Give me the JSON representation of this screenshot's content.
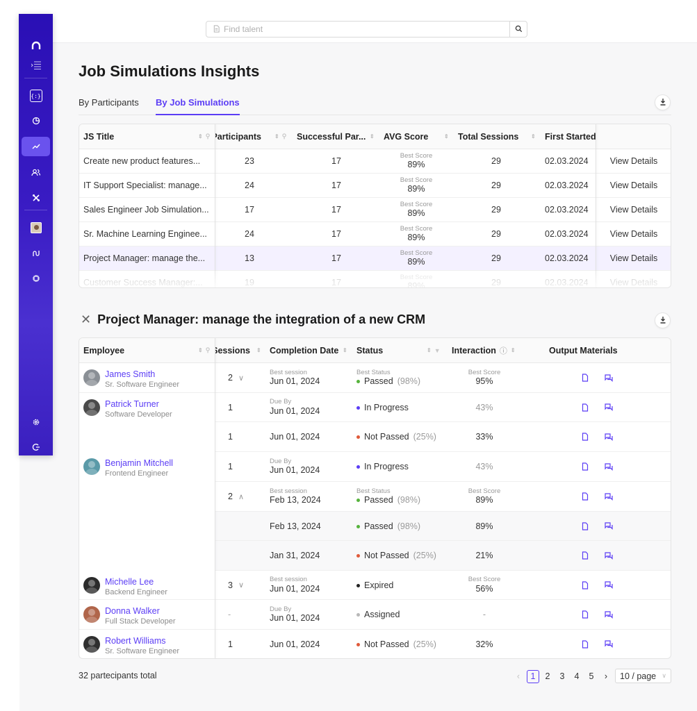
{
  "search": {
    "placeholder": "Find talent"
  },
  "page": {
    "title": "Job Simulations Insights"
  },
  "tabs": [
    {
      "label": "By Participants",
      "active": false
    },
    {
      "label": "By Job Simulations",
      "active": true
    }
  ],
  "colors": {
    "accent": "#5b3df5",
    "sidebar": "#3a1cc4",
    "passed": "#56b33c",
    "not_passed": "#e05a3a",
    "in_progress": "#5b3df5",
    "expired": "#222222",
    "assigned": "#b8b8b8"
  },
  "sidebar": {
    "icons": [
      "logo-icon",
      "menu-collapse-icon",
      "code-braces-icon",
      "pie-chart-icon",
      "trend-chart-icon",
      "users-icon",
      "tools-icon",
      "profile-avatar",
      "route-icon",
      "chip-icon",
      "settings-icon",
      "logout-icon"
    ]
  },
  "js_table": {
    "headers": {
      "title": "JS Title",
      "participants": "Participants",
      "successful": "Successful Par...",
      "avg": "AVG Score",
      "sessions": "Total Sessions",
      "first": "First Started"
    },
    "rows": [
      {
        "title": "Create new product features...",
        "participants": "23",
        "successful": "17",
        "score_label": "Best Score",
        "score": "89%",
        "sessions": "29",
        "first": "02.03.2024",
        "action": "View Details"
      },
      {
        "title": "IT Support Specialist: manage...",
        "participants": "24",
        "successful": "17",
        "score_label": "Best Score",
        "score": "89%",
        "sessions": "29",
        "first": "02.03.2024",
        "action": "View Details"
      },
      {
        "title": "Sales Engineer Job Simulation...",
        "participants": "17",
        "successful": "17",
        "score_label": "Best Score",
        "score": "89%",
        "sessions": "29",
        "first": "02.03.2024",
        "action": "View Details"
      },
      {
        "title": "Sr. Machine Learning Enginee...",
        "participants": "24",
        "successful": "17",
        "score_label": "Best Score",
        "score": "89%",
        "sessions": "29",
        "first": "02.03.2024",
        "action": "View Details"
      },
      {
        "title": "Project Manager: manage the...",
        "participants": "13",
        "successful": "17",
        "score_label": "Best Score",
        "score": "89%",
        "sessions": "29",
        "first": "02.03.2024",
        "action": "View Details"
      },
      {
        "title": "Customer Success Manager:...",
        "participants": "19",
        "successful": "17",
        "score_label": "Best Score",
        "score": "89%",
        "sessions": "29",
        "first": "02.03.2024",
        "action": "View Details"
      }
    ]
  },
  "details": {
    "title": "Project Manager: manage the integration of a new CRM",
    "headers": {
      "employee": "Employee",
      "sessions": "Sessions",
      "completion": "Completion Date",
      "status": "Status",
      "interaction": "Interaction",
      "output": "Output Materials"
    },
    "rows": [
      {
        "name": "James Smith",
        "role": "Sr. Software Engineer",
        "sessions": "2",
        "chev": "∨",
        "date_label": "Best session",
        "date": "Jun 01, 2024",
        "status_label": "Best Status",
        "status": "Passed",
        "status_pct": "(98%)",
        "score_label": "Best Score",
        "score": "95%"
      },
      {
        "name": "Patrick Turner",
        "role": "Software Developer",
        "sessions": "1",
        "date_label": "Due By",
        "date": "Jun 01, 2024",
        "status": "In Progress",
        "score": "43%"
      },
      {
        "sessions": "1",
        "date": "Jun 01, 2024",
        "status": "Not Passed",
        "status_pct": "(25%)",
        "score": "33%"
      },
      {
        "name": "Benjamin Mitchell",
        "role": "Frontend Engineer",
        "sessions": "1",
        "date_label": "Due By",
        "date": "Jun 01, 2024",
        "status": "In Progress",
        "score": "43%"
      },
      {
        "sessions": "2",
        "chev": "∧",
        "date_label": "Best session",
        "date": "Feb 13, 2024",
        "status_label": "Best Status",
        "status": "Passed",
        "status_pct": "(98%)",
        "score_label": "Best Score",
        "score": "89%"
      },
      {
        "date": "Feb 13, 2024",
        "status": "Passed",
        "status_pct": "(98%)",
        "score": "89%"
      },
      {
        "date": "Jan 31, 2024",
        "status": "Not Passed",
        "status_pct": "(25%)",
        "score": "21%"
      },
      {
        "name": "Michelle Lee",
        "role": "Backend Engineer",
        "sessions": "3",
        "chev": "∨",
        "date_label": "Best session",
        "date": "Jun 01, 2024",
        "status": "Expired",
        "score_label": "Best Score",
        "score": "56%"
      },
      {
        "name": "Donna Walker",
        "role": "Full Stack Developer",
        "sessions": "-",
        "date_label": "Due By",
        "date": "Jun 01, 2024",
        "status": "Assigned",
        "score": "-"
      },
      {
        "name": "Robert Williams",
        "role": "Sr. Software Engineer",
        "sessions": "1",
        "date": "Jun 01, 2024",
        "status": "Not Passed",
        "status_pct": "(25%)",
        "score": "32%"
      }
    ]
  },
  "footer": {
    "total": "32 partecipants total",
    "pages": [
      "1",
      "2",
      "3",
      "4",
      "5"
    ],
    "current_page": "1",
    "page_size": "10 / page"
  }
}
